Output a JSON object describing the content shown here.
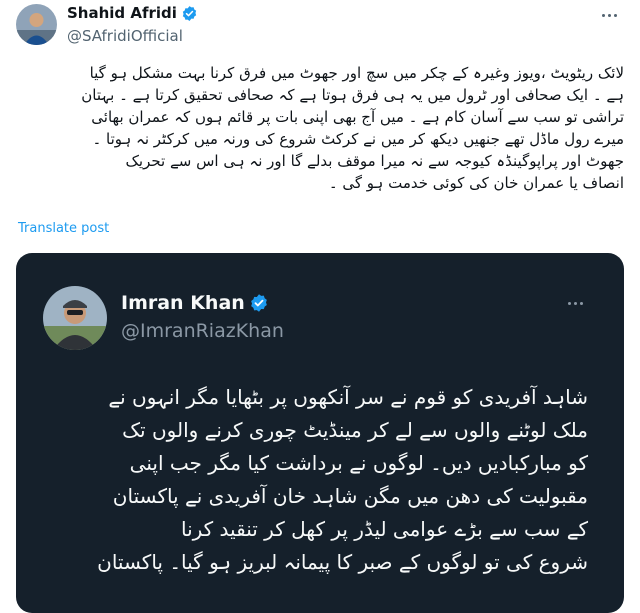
{
  "tweet": {
    "author_name": "Shahid Afridi",
    "author_handle": "@SAfridiOfficial",
    "lines": [
      "لائک ریٹویٹ ،ویوز وغیرہ کے چکر میں سچ اور جھوٹ میں فرق کرنا بہت مشکل ہو گیا",
      "ہے ۔ ایک صحافی اور ٹرول میں یہ ہی فرق ہوتا ہے کہ صحافی تحقیق کرتا ہے ۔ بہتان",
      "تراشی  تو سب سے آسان کام ہے ۔ میں آج بھی اپنی بات پر قائم ہوں کہ عمران بھائی",
      "میرے رول ماڈل تھے جنھیں دیکھ کر میں نے کرکٹ شروع کی ورنہ میں کرکٹر نہ ہوتا ۔",
      "جھوٹ اور پراپوگینڈہ کیوجہ سے نہ میرا موقف بدلے گا اور نہ ہی اس سے تحریک",
      "انصاف یا عمران خان کی کوئی خدمت ہو گی ۔"
    ],
    "translate_label": "Translate post"
  },
  "quoted": {
    "author_name": "Imran Khan",
    "author_handle": "@ImranRiazKhan",
    "lines": [
      "شاہد آفریدی کو قوم نے سر آنکھوں پر بٹھایا مگر انہوں نے",
      "ملک لوٹنے والوں سے لے کر مینڈیٹ چوری کرنے والوں تک",
      "کو مبارکبادیں دیں۔ لوگوں نے برداشت کیا مگر جب اپنی",
      "مقبولیت کی دھن میں مگن شاہد خان آفریدی نے پاکستان",
      "کے سب سے بڑے  عوامی  لیڈر پر کھل کر تنقید کرنا",
      "شروع کی تو لوگوں کے صبر کا پیمانہ لبریز ہو گیا۔ پاکستان"
    ]
  },
  "icons": {
    "verified": "verified-badge-icon",
    "more": "more-options-icon"
  },
  "colors": {
    "accent": "#1d9bf0",
    "card_bg": "#15202b"
  }
}
